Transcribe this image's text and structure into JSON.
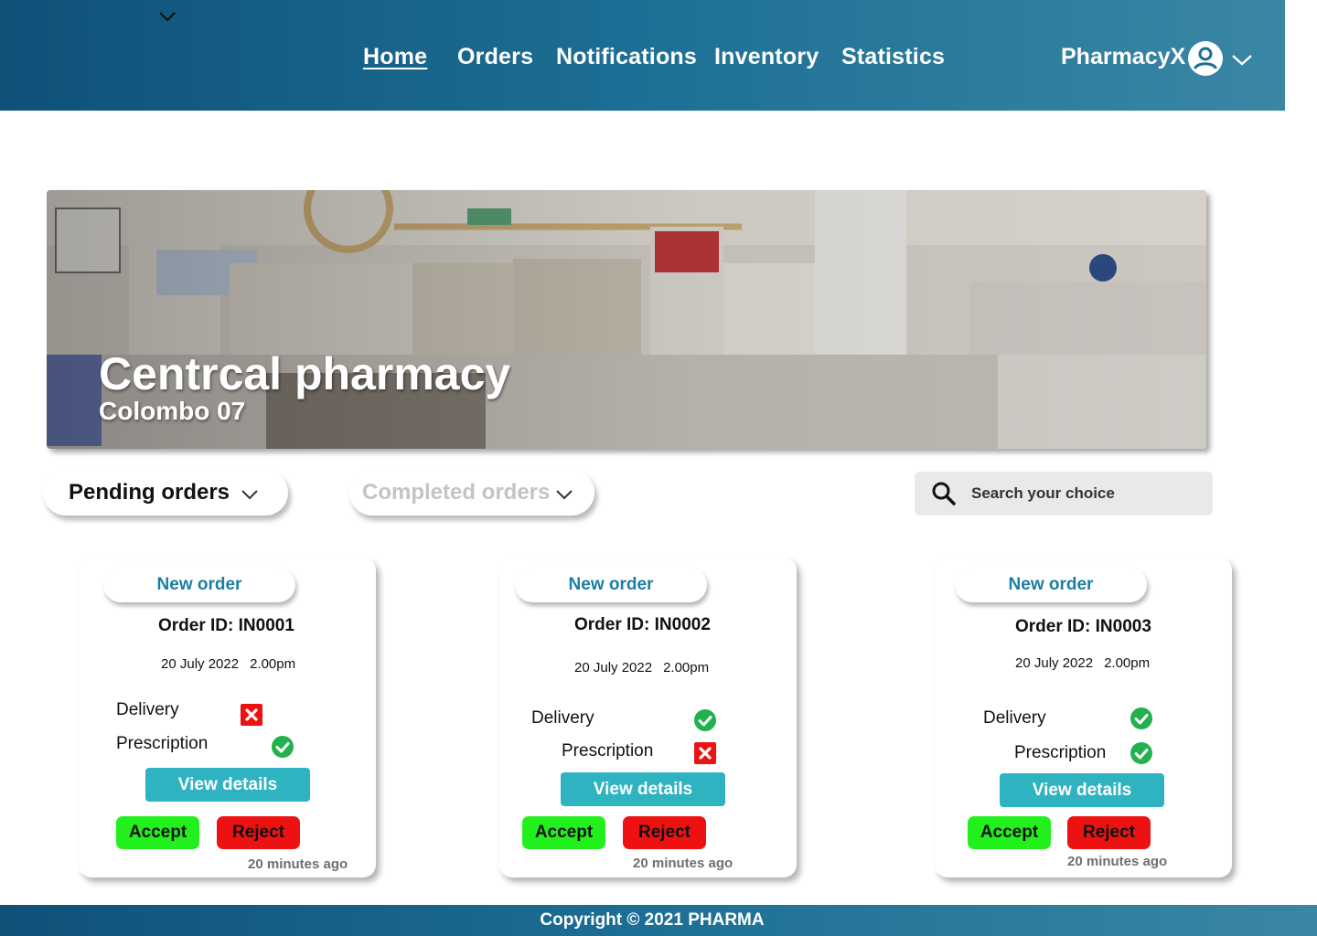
{
  "header": {
    "nav": [
      {
        "label": "Home",
        "active": true
      },
      {
        "label": "Orders",
        "active": false
      },
      {
        "label": "Notifications",
        "active": false
      },
      {
        "label": "Inventory",
        "active": false
      },
      {
        "label": "Statistics",
        "active": false
      }
    ],
    "brand": "PharmacyX",
    "user_icon": "user-circle-icon",
    "menu_icon": "chevron-down-icon"
  },
  "hero": {
    "title": "Centrcal pharmacy",
    "subtitle": "Colombo 07"
  },
  "filters": {
    "pending_label": "Pending orders",
    "completed_label": "Completed orders"
  },
  "search": {
    "placeholder": "Search your choice"
  },
  "orders": [
    {
      "badge": "New order",
      "order_id": "Order ID: IN0001",
      "date": "20 July 2022",
      "time": "2.00pm",
      "delivery_label": "Delivery",
      "delivery": false,
      "prescription_label": "Prescription",
      "prescription": true,
      "view_label": "View details",
      "accept_label": "Accept",
      "reject_label": "Reject",
      "ago": "20 minutes ago"
    },
    {
      "badge": "New order",
      "order_id": "Order ID: IN0002",
      "date": "20 July 2022",
      "time": "2.00pm",
      "delivery_label": "Delivery",
      "delivery": true,
      "prescription_label": "Prescription",
      "prescription": false,
      "view_label": "View details",
      "accept_label": "Accept",
      "reject_label": "Reject",
      "ago": "20 minutes ago"
    },
    {
      "badge": "New order",
      "order_id": "Order ID: IN0003",
      "date": "20 July 2022",
      "time": "2.00pm",
      "delivery_label": "Delivery",
      "delivery": true,
      "prescription_label": "Prescription",
      "prescription": true,
      "view_label": "View details",
      "accept_label": "Accept",
      "reject_label": "Reject",
      "ago": "20 minutes ago"
    }
  ],
  "footer": {
    "copyright": "Copyright © 2021 PHARMA"
  },
  "colors": {
    "header_start": "#0f5178",
    "header_end": "#3a87a4",
    "badge_text": "#1a7fa3",
    "view_button": "#2fb3c1",
    "accept_button": "#22f01c",
    "reject_button": "#ee1111",
    "check": "#22b14c",
    "cross": "#ee1111"
  }
}
